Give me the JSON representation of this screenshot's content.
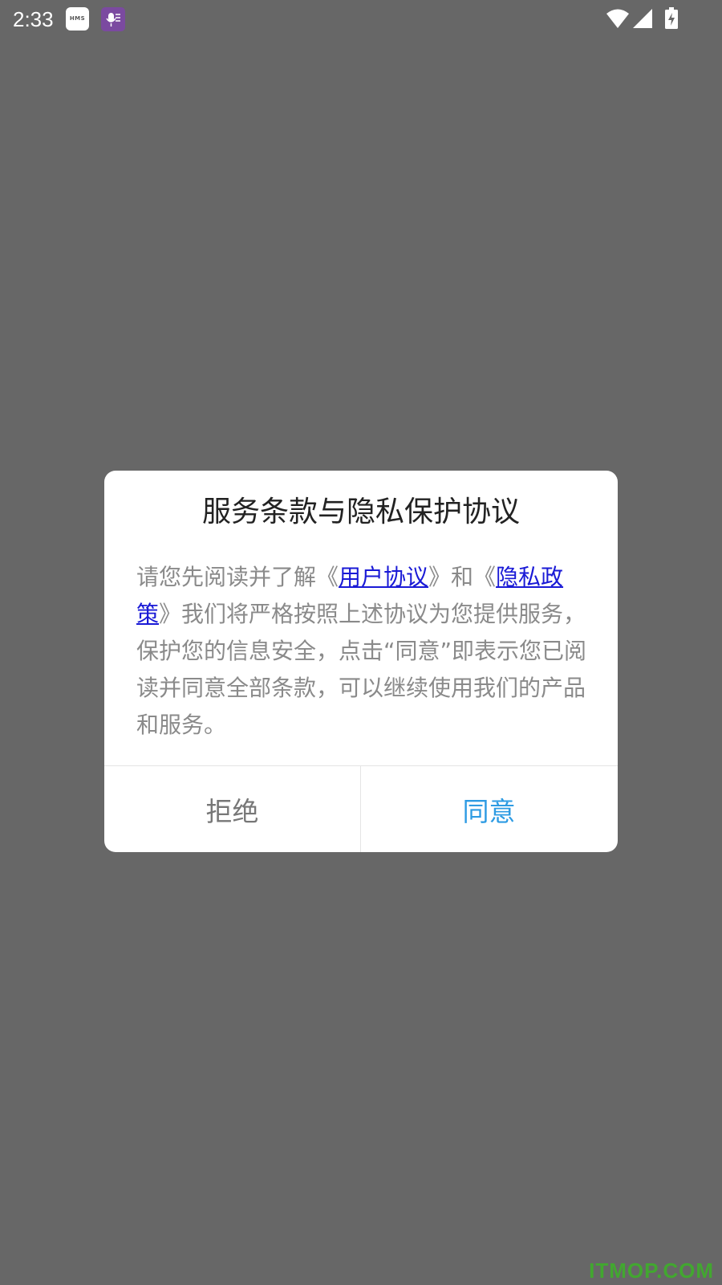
{
  "status_bar": {
    "time": "2:33",
    "hms_badge": "HMS",
    "icons": [
      "hms-icon",
      "voice-icon",
      "wifi-icon",
      "signal-icon",
      "battery-charging-icon"
    ]
  },
  "dialog": {
    "title": "服务条款与隐私保护协议",
    "body": {
      "part1": "请您先阅读并了解《",
      "link_user_agreement": "用户协议",
      "part2": "》和《",
      "link_privacy_policy": "隐私政策",
      "part3": "》我们将严格按照上述协议为您提供服务，保护您的信息安全，点击“同意”即表示您已阅读并同意全部条款，可以继续使用我们的产品和服务。"
    },
    "reject_label": "拒绝",
    "agree_label": "同意"
  },
  "watermark": "ITMOP.COM",
  "colors": {
    "overlay_background": "#676767",
    "agree_button": "#2d9be3",
    "link": "#1a1ad6",
    "body_text": "#8a8a8a"
  }
}
